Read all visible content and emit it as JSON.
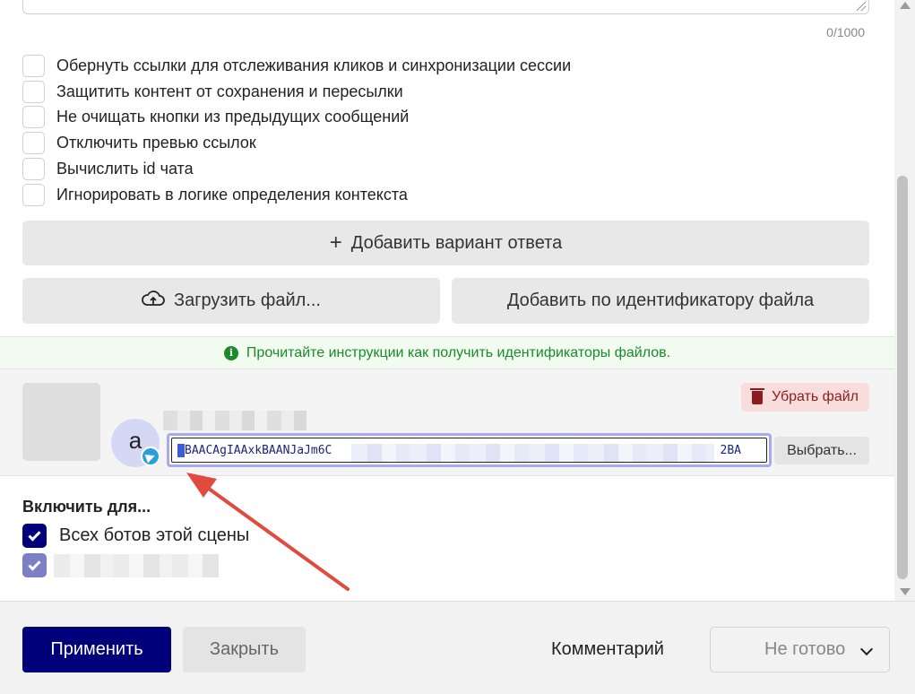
{
  "message": {
    "char_counter": "0/1000"
  },
  "options": [
    {
      "label": "Обернуть ссылки для отслеживания кликов и синхронизации сессии",
      "checked": false
    },
    {
      "label": "Защитить контент от сохранения и пересылки",
      "checked": false
    },
    {
      "label": "Не очищать кнопки из предыдущих сообщений",
      "checked": false
    },
    {
      "label": "Отключить превью ссылок",
      "checked": false
    },
    {
      "label": "Вычислить id чата",
      "checked": false
    },
    {
      "label": "Игнорировать в логике определения контекста",
      "checked": false
    }
  ],
  "actions": {
    "add_answer_label": "Добавить вариант ответа",
    "upload_file_label": "Загрузить файл...",
    "add_by_id_label": "Добавить по идентификатору файла"
  },
  "info": {
    "text": "Прочитайте инструкции как получить идентификаторы файлов."
  },
  "file": {
    "avatar_letter": "a",
    "remove_label": "Убрать файл",
    "file_id_visible_start": "BAACAgIAAxkBAANJaJm6C",
    "file_id_visible_end": "2BA",
    "choose_label": "Выбрать..."
  },
  "enable": {
    "title": "Включить для...",
    "all_bots_label": "Всех ботов этой сцены",
    "all_bots_checked": true,
    "second_checked": true
  },
  "footer": {
    "apply_label": "Применить",
    "close_label": "Закрыть",
    "comment_label": "Комментарий",
    "status_value": "Не готово"
  },
  "colors": {
    "primary": "#00007a",
    "success_text": "#1a8a2a",
    "danger_text": "#8a1e1e",
    "annotation_arrow": "#e04a3f"
  }
}
